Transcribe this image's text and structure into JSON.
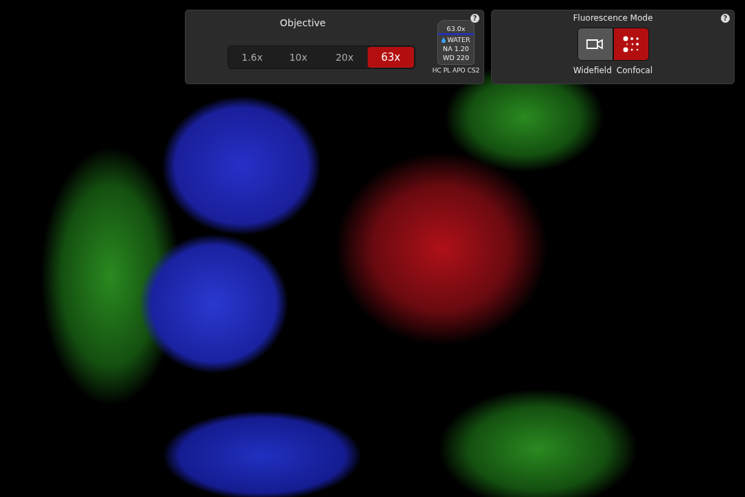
{
  "objective": {
    "title": "Objective",
    "help": "?",
    "options": [
      {
        "label": "1.6x",
        "selected": false
      },
      {
        "label": "10x",
        "selected": false
      },
      {
        "label": "20x",
        "selected": false
      },
      {
        "label": "63x",
        "selected": true
      }
    ],
    "lens": {
      "magnification": "63.0x",
      "immersion": "WATER",
      "na": "NA 1.20",
      "wd": "WD 220",
      "name": "HC PL APO CS2"
    }
  },
  "fluorescence_mode": {
    "title": "Fluorescence Mode",
    "help": "?",
    "modes": [
      {
        "kind": "widefield",
        "label": "Widefield",
        "selected": false
      },
      {
        "kind": "confocal",
        "label": "Confocal",
        "selected": true
      }
    ]
  }
}
